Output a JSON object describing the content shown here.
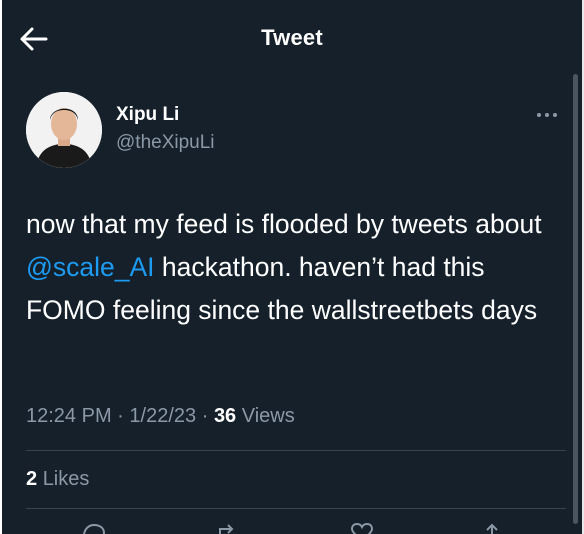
{
  "header": {
    "title": "Tweet",
    "back_icon": "arrow-left-icon"
  },
  "author": {
    "name": "Xipu Li",
    "handle": "@theXipuLi",
    "avatar_icon": "profile-photo"
  },
  "tweet": {
    "text_before": "now that my feed is flooded by tweets about ",
    "mention": "@scale_AI",
    "text_after": " hackathon. haven’t had this FOMO feeling since the wallstreetbets days",
    "time": "12:24 PM",
    "date": "1/22/23",
    "separator": "·",
    "views_count": "36",
    "views_label": "Views"
  },
  "engagement": {
    "likes_count": "2",
    "likes_label": "Likes"
  },
  "actions": [
    {
      "icon": "reply-icon"
    },
    {
      "icon": "retweet-icon"
    },
    {
      "icon": "like-icon"
    },
    {
      "icon": "share-icon"
    }
  ],
  "colors": {
    "background": "#15202b",
    "text_primary": "#ffffff",
    "text_secondary": "#8b98a5",
    "accent": "#1d9bf0",
    "divider": "#38444d"
  }
}
